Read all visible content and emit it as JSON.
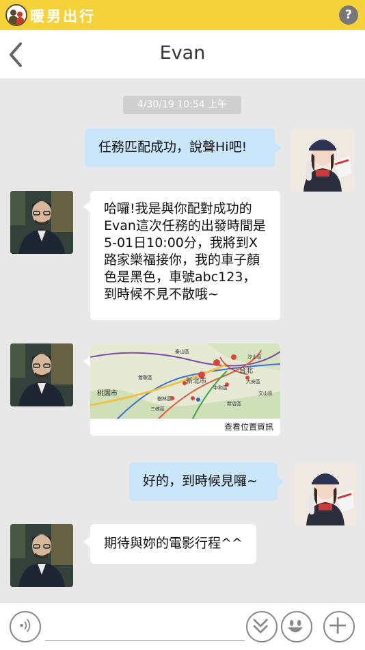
{
  "app": {
    "brand_name": "暖男出行",
    "help_label": "?"
  },
  "header": {
    "title": "Evan"
  },
  "chat": {
    "timestamp": "4/30/19 10:54 上午",
    "messages": [
      {
        "from": "me",
        "text": "任務匹配成功，說聲Hi吧!"
      },
      {
        "from": "other",
        "text": "哈囉!我是與你配對成功的Evan這次任務的出發時間是5-01日10:00分，我將到X路家樂福接你，我的車子顏色是黑色，車號abc123，到時候不見不散哦~"
      },
      {
        "from": "other",
        "type": "map",
        "link_text": "查看位置資訊",
        "labels": [
          "桃園市",
          "新北市",
          "台北",
          "鶯歌區",
          "樹林區",
          "中和區",
          "大安區",
          "文山區",
          "三峽區",
          "新店區",
          "泰山區",
          "汐止區"
        ]
      },
      {
        "from": "me",
        "text": "好的，到時候見囉~"
      },
      {
        "from": "other",
        "text": "期待與妳的電影行程^^"
      }
    ]
  },
  "composer": {
    "placeholder": ""
  },
  "icons": {
    "brand": "brand-logo-icon",
    "help": "help-icon",
    "back": "back-chevron-icon",
    "voice": "voice-icon",
    "collapse": "double-chevron-down-icon",
    "emoji": "smiley-icon",
    "add": "plus-icon"
  },
  "colors": {
    "brand_yellow": "#f6d23a",
    "my_bubble": "#c9e6fa",
    "chat_bg": "#e8e8e8"
  }
}
